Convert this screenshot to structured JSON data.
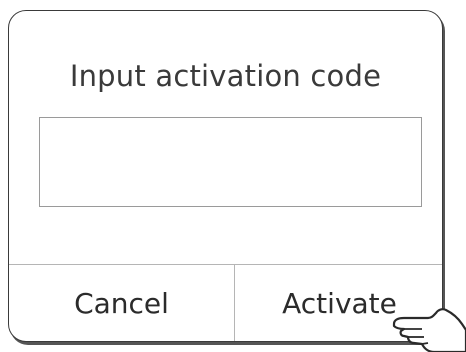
{
  "dialog": {
    "title": "Input activation code",
    "input": {
      "value": "",
      "placeholder": ""
    },
    "buttons": {
      "cancel_label": "Cancel",
      "activate_label": "Activate"
    }
  },
  "icons": {
    "pointer": "pointing-hand-icon"
  }
}
